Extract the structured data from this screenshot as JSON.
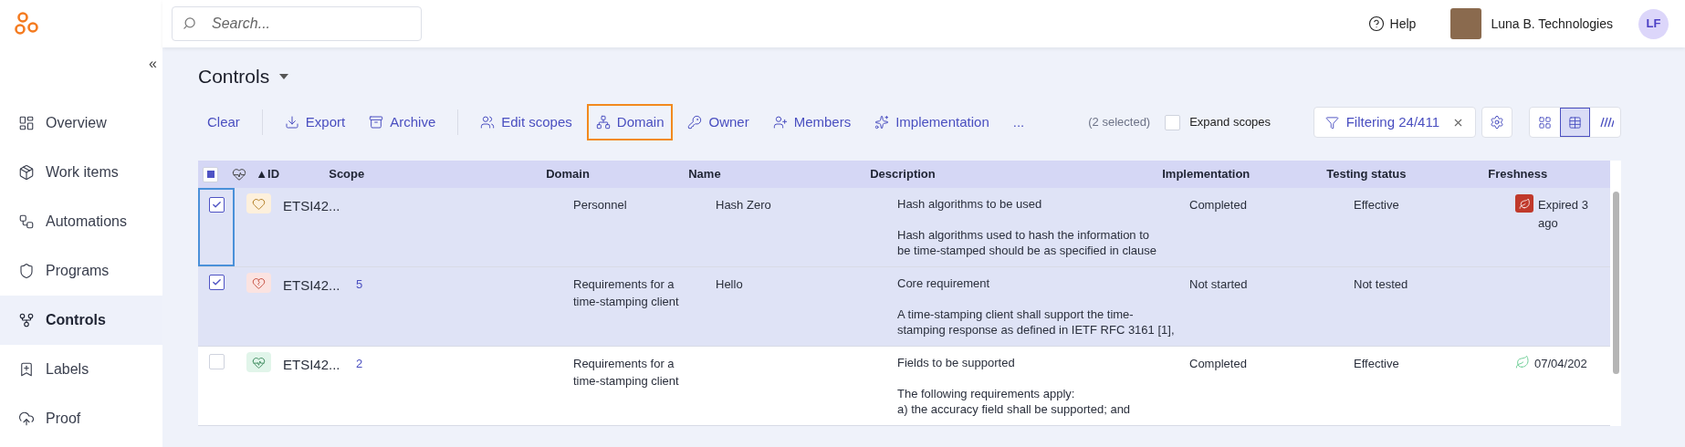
{
  "sidebar": {
    "collapse_label": "«",
    "items": [
      {
        "label": "Overview",
        "selected": false
      },
      {
        "label": "Work items",
        "selected": false
      },
      {
        "label": "Automations",
        "selected": false
      },
      {
        "label": "Programs",
        "selected": false
      },
      {
        "label": "Controls",
        "selected": true
      },
      {
        "label": "Labels",
        "selected": false
      },
      {
        "label": "Proof",
        "selected": false
      }
    ]
  },
  "topbar": {
    "search": {
      "placeholder": "Search..."
    },
    "help": "Help",
    "organization": "Luna B. Technologies",
    "user_initials": "LF"
  },
  "page": {
    "title": "Controls"
  },
  "toolbar": {
    "groups": [
      [
        {
          "label": "Clear",
          "highlighted": false
        }
      ],
      [
        {
          "label": "Export",
          "highlighted": false
        },
        {
          "label": "Archive",
          "highlighted": false
        }
      ],
      [
        {
          "label": "Edit scopes",
          "highlighted": false
        },
        {
          "label": "Domain",
          "highlighted": true
        },
        {
          "label": "Owner",
          "highlighted": false
        },
        {
          "label": "Members",
          "highlighted": false
        },
        {
          "label": "Implementation",
          "highlighted": false
        },
        {
          "label": "...",
          "highlighted": false
        }
      ]
    ],
    "selection_count": "(2 selected)",
    "expand_scopes": {
      "label": "Expand scopes",
      "checked": false
    },
    "filter": "Filtering 24/411",
    "views": [
      {
        "selected": false
      },
      {
        "selected": true
      },
      {
        "selected": false
      }
    ]
  },
  "table": {
    "select_all": {
      "indeterminate": true
    },
    "columns": [
      "▲ID",
      "Scope",
      "Domain",
      "Name",
      "Description",
      "Implementation",
      "Testing status",
      "Freshness"
    ],
    "rows": [
      {
        "selected": true,
        "focused": true,
        "kind": "warning",
        "id": "ETSI42...",
        "scope": "",
        "domain": "Personnel",
        "name": "Hash Zero",
        "description_title": "Hash algorithms to be used",
        "description_body": [
          "Hash algorithms used to hash the information to",
          "be time-stamped should be as specified in clause"
        ],
        "implementation": "Completed",
        "testing_status": "Effective",
        "freshness": {
          "kind": "expired",
          "lines": [
            "Expired 3",
            "ago"
          ]
        }
      },
      {
        "selected": true,
        "focused": false,
        "kind": "broken",
        "id": "ETSI42...",
        "scope": "5",
        "domain": "Requirements for a time-stamping client",
        "name": "Hello",
        "description_title": "Core requirement",
        "description_body": [
          "A time-stamping client shall support the time-",
          "stamping response as defined in IETF RFC 3161 [1],"
        ],
        "implementation": "Not started",
        "testing_status": "Not tested"
      },
      {
        "selected": false,
        "focused": false,
        "kind": "healthy",
        "id": "ETSI42...",
        "scope": "2",
        "domain": "Requirements for a time-stamping client",
        "name": "",
        "description_title": "Fields to be supported",
        "description_body": [
          "The following requirements apply:",
          "a) the accuracy field shall be supported; and"
        ],
        "implementation": "Completed",
        "testing_status": "Effective",
        "freshness": {
          "kind": "fresh",
          "lines": [
            "07/04/202"
          ]
        }
      }
    ]
  }
}
